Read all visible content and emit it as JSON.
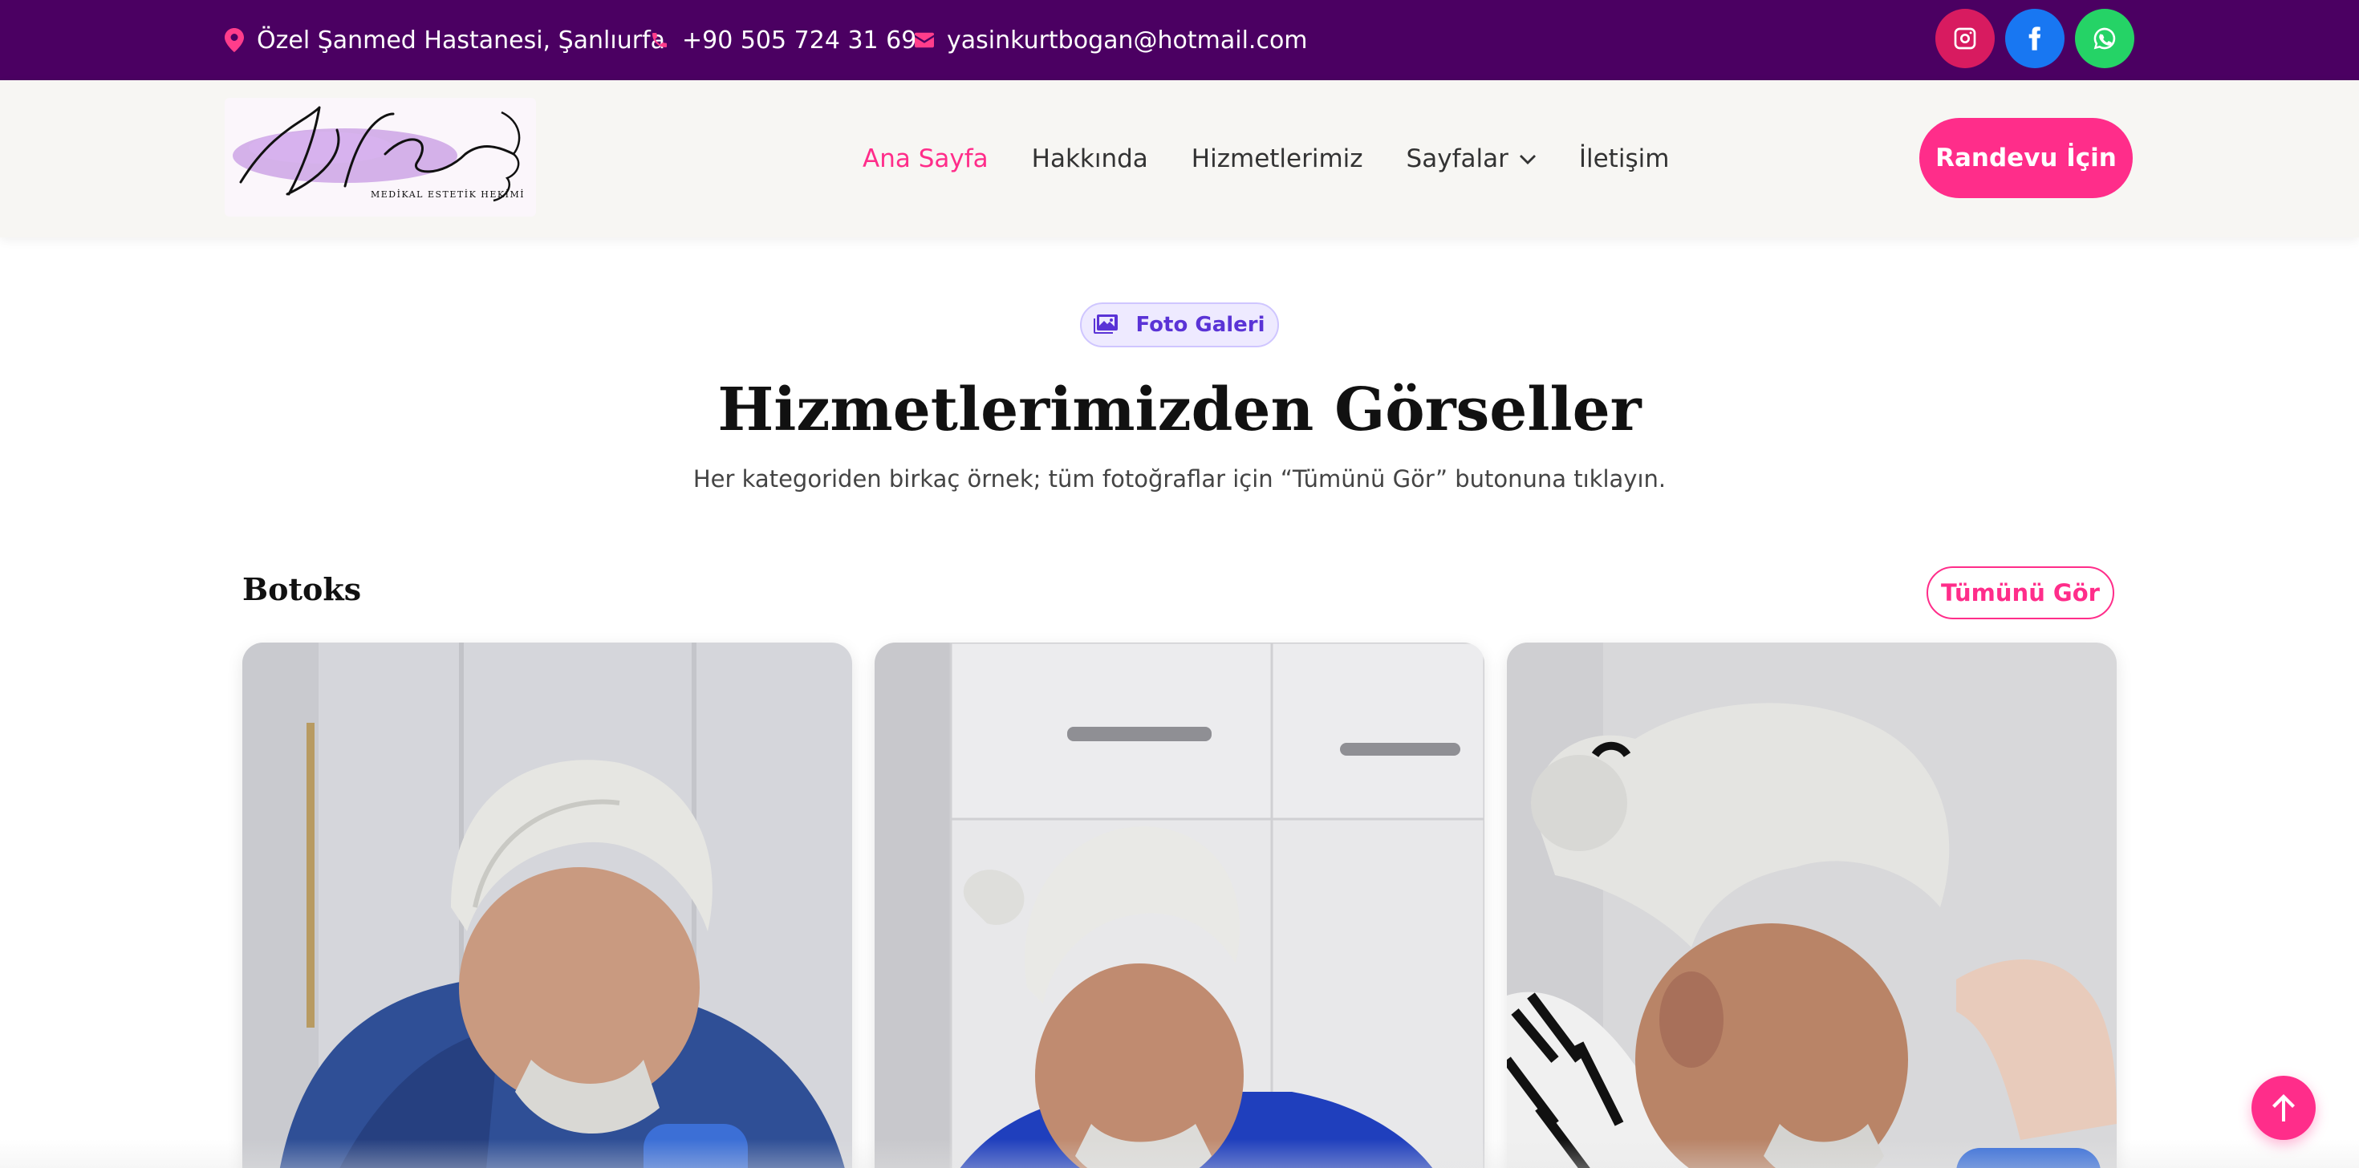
{
  "topbar": {
    "location": "Özel Şanmed Hastanesi, Şanlıurfa",
    "phone": "+90 505 724 31 69",
    "email": "yasinkurtbogan@hotmail.com",
    "social": [
      "instagram-icon",
      "facebook-icon",
      "whatsapp-icon"
    ]
  },
  "logo": {
    "script": "Dr. Kurtboğan",
    "tagline": "MEDİKAL ESTETİK HEKİMİ"
  },
  "nav": {
    "items": [
      "Ana Sayfa",
      "Hakkında",
      "Hizmetlerimiz",
      "Sayfalar",
      "İletişim"
    ],
    "active": "Ana Sayfa"
  },
  "cta": {
    "label": "Randevu İçin"
  },
  "section": {
    "badge": "Foto Galeri",
    "title": "Hizmetlerimizden Görseller",
    "subtitle": "Her kategoriden birkaç örnek; tüm fotoğraflar için “Tümünü Gör” butonuna tıklayın."
  },
  "category": {
    "name": "Botoks",
    "see_all": "Tümünü Gör"
  },
  "colors": {
    "topbar": "#4b0062",
    "accent": "#ff2d8a",
    "badge_text": "#5a33d6"
  }
}
